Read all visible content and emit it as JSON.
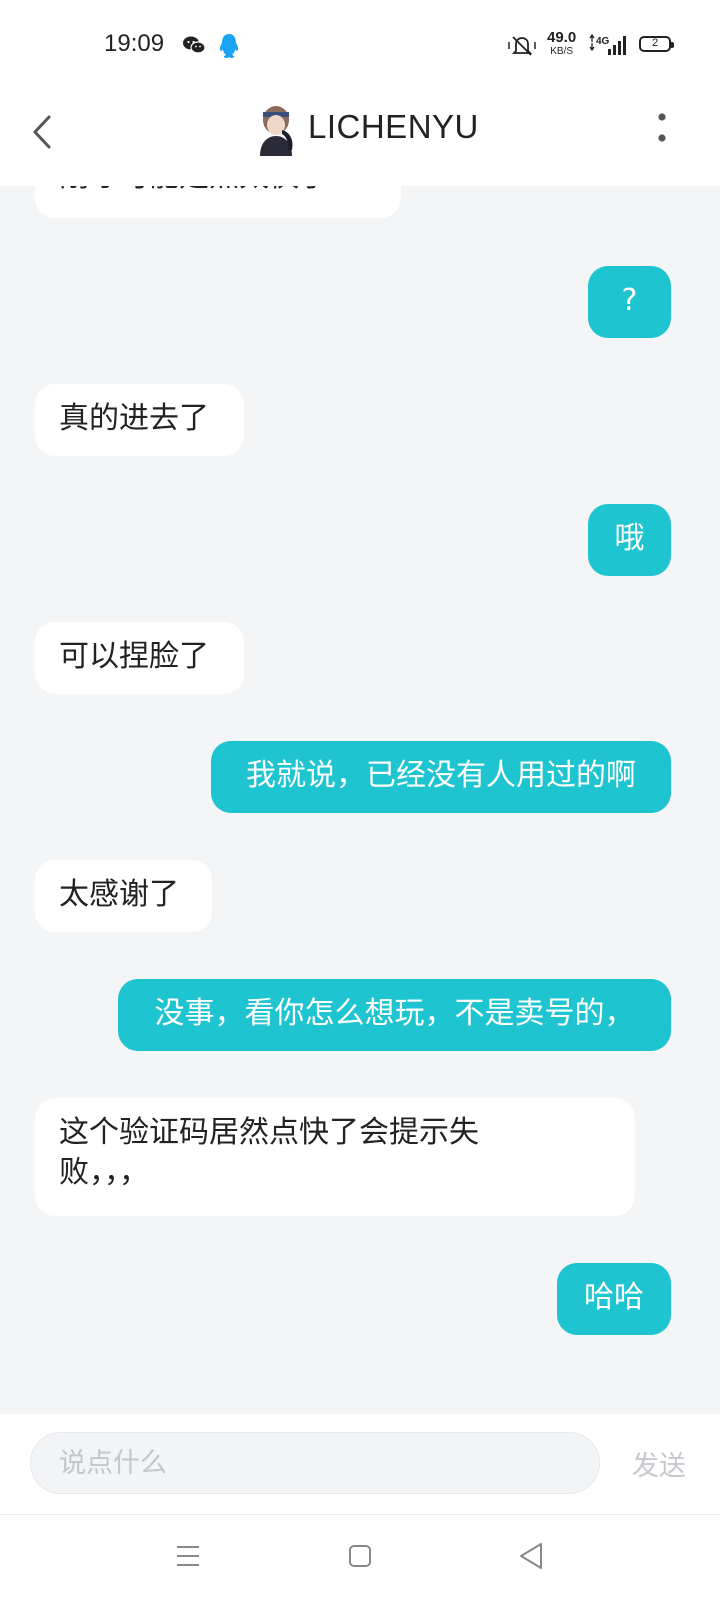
{
  "status_bar": {
    "time": "19:09",
    "speed_value": "49.0",
    "speed_unit": "KB/S",
    "network": "4G",
    "battery": "2",
    "icons": [
      "wechat-icon",
      "qq-icon",
      "mute-icon",
      "signal-icon",
      "battery-icon"
    ]
  },
  "header": {
    "title": "LICHENYU",
    "icons": [
      "back-icon",
      "avatar",
      "more-icon"
    ]
  },
  "messages": [
    {
      "direction": "in",
      "text": "刚才可能是点太快了"
    },
    {
      "direction": "out",
      "text": "?"
    },
    {
      "direction": "in",
      "text": "真的进去了"
    },
    {
      "direction": "out",
      "text": "哦"
    },
    {
      "direction": "in",
      "text": "可以捏脸了"
    },
    {
      "direction": "out",
      "text": "我就说，已经没有人用过的啊"
    },
    {
      "direction": "in",
      "text": "太感谢了"
    },
    {
      "direction": "out",
      "text": "没事，看你怎么想玩，不是卖号的，"
    },
    {
      "direction": "in",
      "text": "这个验证码居然点快了会提示失败，，，"
    },
    {
      "direction": "out",
      "text": "哈哈"
    }
  ],
  "input": {
    "placeholder": "说点什么",
    "send_label": "发送"
  },
  "colors": {
    "accent": "#1ec4cf",
    "background": "#f4f5f7",
    "incoming_bubble": "#ffffff"
  },
  "nav_bar": {
    "icons": [
      "menu-icon",
      "home-icon",
      "back-nav-icon"
    ]
  }
}
